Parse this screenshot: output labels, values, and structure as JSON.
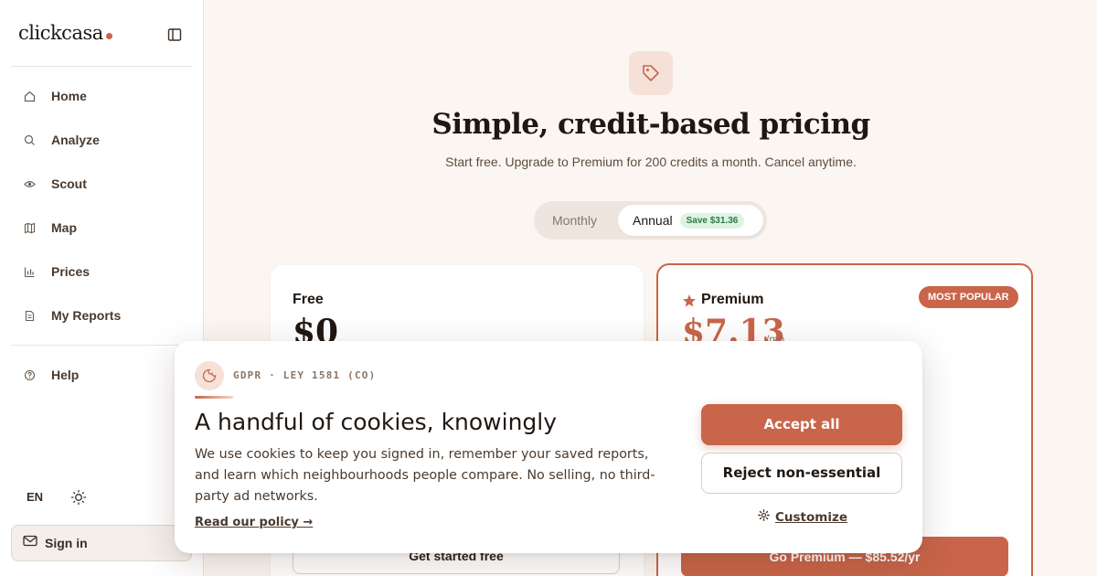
{
  "brand": {
    "name": "clickcasa",
    "accent": "#c8654a"
  },
  "sidebar": {
    "items": [
      {
        "label": "Home",
        "icon": "home-icon"
      },
      {
        "label": "Analyze",
        "icon": "search-icon"
      },
      {
        "label": "Scout",
        "icon": "eye-icon"
      },
      {
        "label": "Map",
        "icon": "map-icon"
      },
      {
        "label": "Prices",
        "icon": "bar-chart-icon"
      },
      {
        "label": "My Reports",
        "icon": "document-icon"
      }
    ],
    "help": {
      "label": "Help",
      "icon": "help-icon"
    },
    "language": "EN",
    "signin": "Sign in"
  },
  "hero": {
    "title": "Simple, credit-based pricing",
    "subtitle": "Start free. Upgrade to Premium for 200 credits a month. Cancel anytime."
  },
  "billing": {
    "monthly": "Monthly",
    "annual": "Annual",
    "save_badge": "Save $31.36",
    "selected": "Annual"
  },
  "plans": {
    "free": {
      "name": "Free",
      "price": "$0",
      "cta": "Get started free"
    },
    "premium": {
      "name": "Premium",
      "price": "$7.13",
      "unit": "/mo",
      "badge": "MOST POPULAR",
      "cta": "Go Premium — $85.52/yr"
    }
  },
  "cookie": {
    "tag": "GDPR · LEY 1581 (CO)",
    "title": "A handful of cookies, knowingly",
    "body": "We use cookies to keep you signed in, remember your saved reports, and learn which neighbourhoods people compare. No selling, no third-party ad networks.",
    "policy": "Read our policy →",
    "accept": "Accept all",
    "reject": "Reject non-essential",
    "customize": "Customize"
  }
}
